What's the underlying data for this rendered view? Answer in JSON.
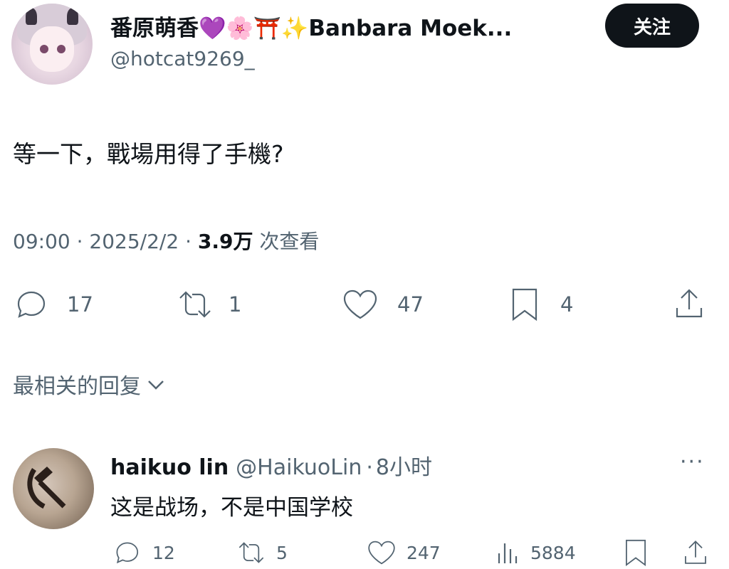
{
  "post": {
    "display_name": "番原萌香💜🌸⛩️✨Banbara Moek...",
    "handle": "@hotcat9269_",
    "follow_label": "关注",
    "text": "等一下，戰場用得了手機?",
    "time": "09:00",
    "date": "2025/2/2",
    "views_count": "3.9万",
    "views_label": "次查看",
    "actions": {
      "reply_count": "17",
      "retweet_count": "1",
      "like_count": "47",
      "bookmark_count": "4"
    }
  },
  "replies_sort_label": "最相关的回复",
  "reply": {
    "name": "haikuo lin",
    "handle": "@HaikuoLin",
    "time": "8小时",
    "text": "这是战场，不是中国学校",
    "more": "···",
    "actions": {
      "reply_count": "12",
      "retweet_count": "5",
      "like_count": "247",
      "views_count": "5884"
    }
  },
  "colors": {
    "text": "#0f1419",
    "secondary": "#536471",
    "button_bg": "#0f1419"
  },
  "icons": [
    "reply-icon",
    "retweet-icon",
    "like-icon",
    "bookmark-icon",
    "share-icon",
    "views-icon",
    "chevron-down-icon",
    "more-icon"
  ]
}
